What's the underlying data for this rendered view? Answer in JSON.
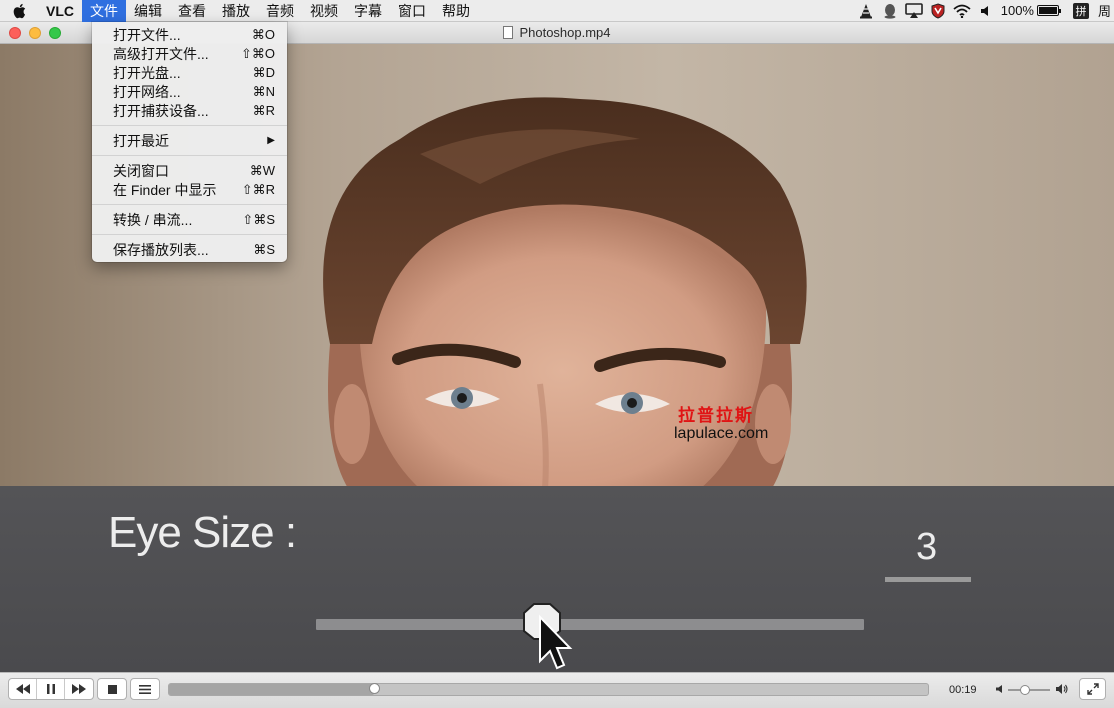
{
  "menubar": {
    "app_name": "VLC",
    "items": [
      "文件",
      "编辑",
      "查看",
      "播放",
      "音频",
      "视频",
      "字幕",
      "窗口",
      "帮助"
    ],
    "active_index": 0,
    "status": {
      "battery_percent_label": "100%",
      "battery_level": 1.0,
      "ime_label": "拼",
      "clock_label": "周"
    },
    "icons": [
      "vlc-cone-icon",
      "qq-penguin-icon",
      "airplay-display-icon",
      "shield-icon",
      "wifi-icon",
      "volume-icon",
      "battery-icon"
    ]
  },
  "window": {
    "title": "Photoshop.mp4"
  },
  "file_menu": {
    "groups": [
      [
        {
          "label": "打开文件...",
          "shortcut": "⌘O"
        },
        {
          "label": "高级打开文件...",
          "shortcut": "⇧⌘O"
        },
        {
          "label": "打开光盘...",
          "shortcut": "⌘D"
        },
        {
          "label": "打开网络...",
          "shortcut": "⌘N"
        },
        {
          "label": "打开捕获设备...",
          "shortcut": "⌘R"
        }
      ],
      [
        {
          "label": "打开最近",
          "submenu": true
        }
      ],
      [
        {
          "label": "关闭窗口",
          "shortcut": "⌘W"
        },
        {
          "label": "在 Finder 中显示",
          "shortcut": "⇧⌘R"
        }
      ],
      [
        {
          "label": "转换 / 串流...",
          "shortcut": "⇧⌘S"
        }
      ],
      [
        {
          "label": "保存播放列表...",
          "shortcut": "⌘S"
        }
      ]
    ]
  },
  "video": {
    "overlay_label": "Eye Size :",
    "overlay_value": "3",
    "slider_fraction": 0.41,
    "watermark_cn": "拉普拉斯",
    "watermark_url": "lapulace.com"
  },
  "controls": {
    "time": "00:19",
    "progress_fraction": 0.27,
    "volume_fraction": 0.4,
    "buttons": [
      "rewind-icon",
      "pause-icon",
      "fast-forward-icon",
      "stop-icon",
      "playlist-icon",
      "fullscreen-icon"
    ]
  },
  "colors": {
    "menu_highlight": "#2f6fe0",
    "watermark_red": "#e01414",
    "overlay_panel": "#4f4f52"
  }
}
